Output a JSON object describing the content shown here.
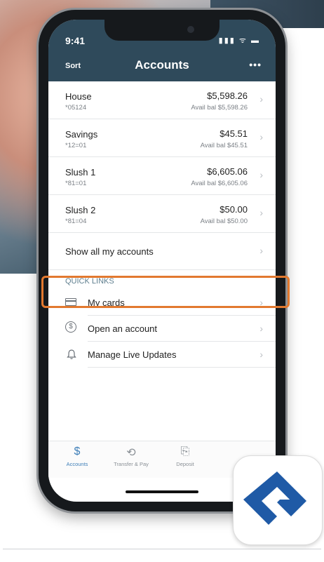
{
  "status_bar": {
    "time": "9:41",
    "icons": "▮▮▮ ᯤ ▬"
  },
  "nav": {
    "sort_label": "Sort",
    "title": "Accounts",
    "more_label": "•••"
  },
  "accounts": [
    {
      "name": "House",
      "number": "*05124",
      "balance": "$5,598.26",
      "avail": "Avail bal $5,598.26"
    },
    {
      "name": "Savings",
      "number": "*12=01",
      "balance": "$45.51",
      "avail": "Avail bal $45.51"
    },
    {
      "name": "Slush 1",
      "number": "*81=01",
      "balance": "$6,605.06",
      "avail": "Avail bal $6,605.06"
    },
    {
      "name": "Slush 2",
      "number": "*81=04",
      "balance": "$50.00",
      "avail": "Avail bal $50.00"
    }
  ],
  "show_all_label": "Show all my accounts",
  "quick_links": {
    "header": "QUICK LINKS",
    "items": [
      {
        "label": "My cards",
        "icon": "card-icon"
      },
      {
        "label": "Open an account",
        "icon": "dollar-circle-icon"
      },
      {
        "label": "Manage Live Updates",
        "icon": "bell-icon"
      }
    ]
  },
  "tabs": [
    {
      "label": "Accounts",
      "icon": "dollar-icon",
      "active": true
    },
    {
      "label": "Transfer & Pay",
      "icon": "transfer-icon",
      "active": false
    },
    {
      "label": "Deposit",
      "icon": "deposit-icon",
      "active": false
    }
  ],
  "colors": {
    "header": "#2f4a5b",
    "highlight": "#e2792f",
    "accent": "#3f7fb8",
    "logo": "#1f5aa6"
  },
  "chevron": "›"
}
